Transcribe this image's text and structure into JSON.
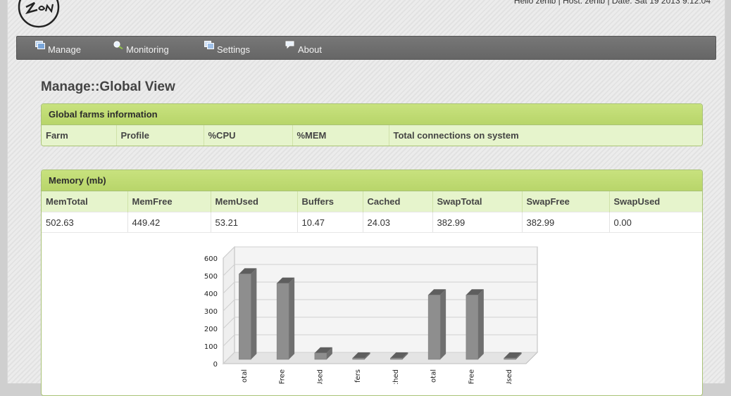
{
  "header": {
    "host_info": "Hello zenlb | Host: zenlb | Date: Sat 19 2013 9:12:04"
  },
  "menu": [
    {
      "label": "Manage",
      "icon": "manage-icon"
    },
    {
      "label": "Monitoring",
      "icon": "magnifier-icon"
    },
    {
      "label": "Settings",
      "icon": "settings-icon"
    },
    {
      "label": "About",
      "icon": "speech-bubble-icon"
    }
  ],
  "page_title": "Manage::Global View",
  "farms_panel": {
    "title": "Global farms information",
    "columns": [
      "Farm",
      "Profile",
      "%CPU",
      "%MEM",
      "Total connections on system"
    ]
  },
  "memory_panel": {
    "title": "Memory (mb)",
    "columns": [
      "MemTotal",
      "MemFree",
      "MemUsed",
      "Buffers",
      "Cached",
      "SwapTotal",
      "SwapFree",
      "SwapUsed"
    ],
    "values": [
      "502.63",
      "449.42",
      "53.21",
      "10.47",
      "24.03",
      "382.99",
      "382.99",
      "0.00"
    ]
  },
  "chart_data": {
    "type": "bar",
    "categories": [
      "MemTotal",
      "MemFree",
      "MemUsed",
      "Buffers",
      "Cached",
      "SwapTotal",
      "SwapFree",
      "SwapUsed"
    ],
    "category_tick_labels": [
      "otal",
      "Free",
      "Used",
      "fers",
      "ched",
      "otal",
      "Free",
      "Used"
    ],
    "values": [
      502.63,
      449.42,
      53.21,
      10.47,
      24.03,
      382.99,
      382.99,
      0.0
    ],
    "ylim": [
      0,
      600
    ],
    "yticks": [
      "0",
      "100",
      "200",
      "300",
      "400",
      "500",
      "600"
    ],
    "grid": true,
    "style": "3d",
    "bar_color": "#8e8e8e"
  }
}
